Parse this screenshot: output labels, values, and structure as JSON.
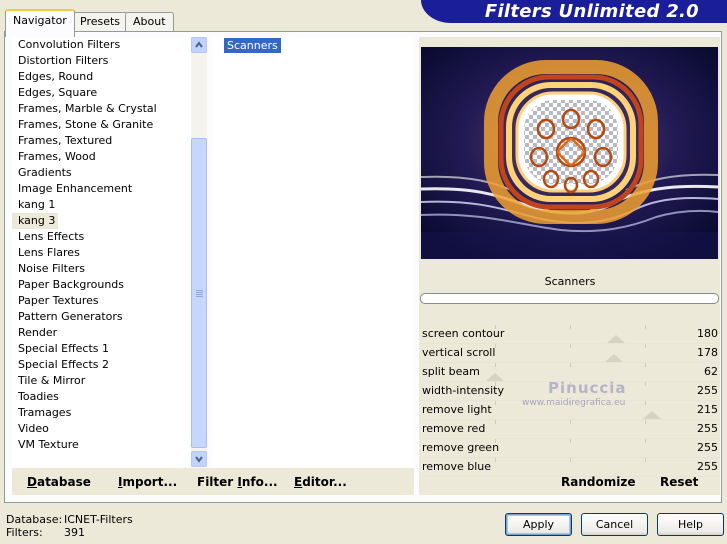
{
  "app": {
    "title": "Filters Unlimited 2.0"
  },
  "tabs": [
    {
      "label": "Navigator",
      "active": true
    },
    {
      "label": "Presets",
      "active": false
    },
    {
      "label": "About",
      "active": false
    }
  ],
  "categories": [
    "Convolution Filters",
    "Distortion Filters",
    "Edges, Round",
    "Edges, Square",
    "Frames, Marble & Crystal",
    "Frames, Stone & Granite",
    "Frames, Textured",
    "Frames, Wood",
    "Gradients",
    "Image Enhancement",
    "kang 1",
    "kang 3",
    "Lens Effects",
    "Lens Flares",
    "Noise Filters",
    "Paper Backgrounds",
    "Paper Textures",
    "Pattern Generators",
    "Render",
    "Special Effects 1",
    "Special Effects 2",
    "Tile & Mirror",
    "Toadies",
    "Tramages",
    "Video",
    "VM Texture"
  ],
  "selected_category": "kang 3",
  "filters": [
    "Scanners"
  ],
  "selected_filter": "Scanners",
  "bottom_buttons": {
    "database": {
      "pre": "",
      "u": "D",
      "post": "atabase"
    },
    "import": {
      "pre": "",
      "u": "I",
      "post": "mport..."
    },
    "filter_info": {
      "pre": "Filter ",
      "u": "I",
      "post": "nfo..."
    },
    "editor": {
      "pre": "",
      "u": "E",
      "post": "ditor..."
    }
  },
  "preview": {
    "watermark_name": "Pinuccia",
    "watermark_url": "www.maidiregrafica.eu"
  },
  "filter_name": "Scanners",
  "progress": 0,
  "params": [
    {
      "name": "screen contour",
      "value": "180",
      "level": 0.706
    },
    {
      "name": "vertical scroll",
      "value": "178",
      "level": 0.698
    },
    {
      "name": "split beam",
      "value": "62",
      "level": 0.243
    },
    {
      "name": "width-intensity",
      "value": "255",
      "level": 1.0
    },
    {
      "name": "remove light",
      "value": "215",
      "level": 0.843
    },
    {
      "name": "remove red",
      "value": "255",
      "level": 1.0
    },
    {
      "name": "remove green",
      "value": "255",
      "level": 1.0
    },
    {
      "name": "remove blue",
      "value": "255",
      "level": 1.0
    }
  ],
  "randomize_label": "Randomize",
  "reset_label": "Reset",
  "status": {
    "database_label": "Database:",
    "database_value": "ICNET-Filters",
    "filters_label": "Filters:",
    "filters_value": "391"
  },
  "dialog_buttons": {
    "apply": "Apply",
    "cancel": "Cancel",
    "help": "Help"
  }
}
